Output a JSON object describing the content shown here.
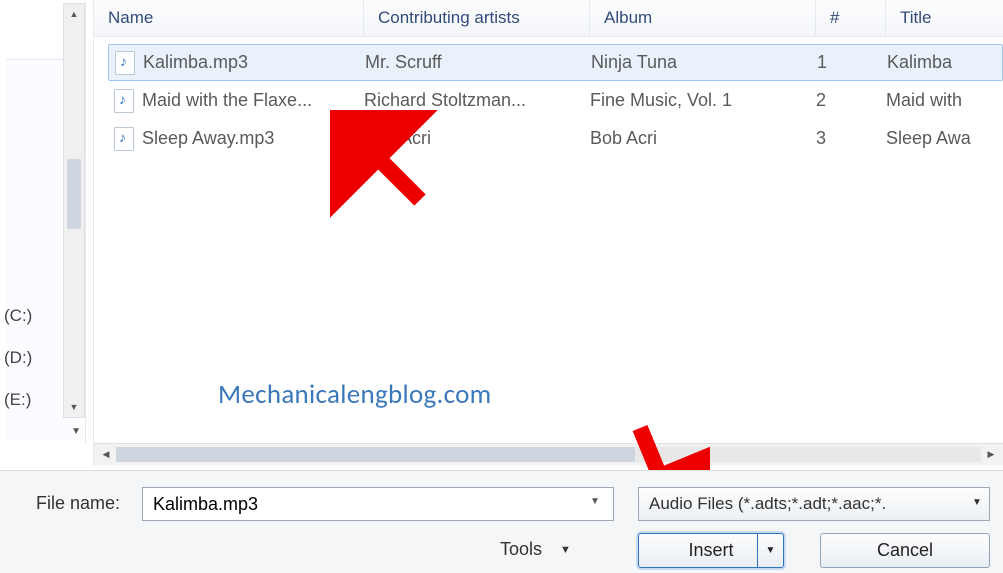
{
  "columns": {
    "name": "Name",
    "artist": "Contributing artists",
    "album": "Album",
    "num": "#",
    "title": "Title"
  },
  "rows": [
    {
      "name": "Kalimba.mp3",
      "artist": "Mr. Scruff",
      "album": "Ninja Tuna",
      "num": "1",
      "title": "Kalimba",
      "selected": true
    },
    {
      "name": "Maid with the Flaxe...",
      "artist": "Richard Stoltzman...",
      "album": "Fine Music, Vol. 1",
      "num": "2",
      "title": "Maid with",
      "selected": false
    },
    {
      "name": "Sleep Away.mp3",
      "artist": "Bob Acri",
      "album": "Bob Acri",
      "num": "3",
      "title": "Sleep Awa",
      "selected": false
    }
  ],
  "drives": [
    "(C:)",
    "(D:)",
    "(E:)"
  ],
  "watermark": "Mechanicalengblog.com",
  "bottom": {
    "file_label": "File name:",
    "file_value": "Kalimba.mp3",
    "filter": "Audio Files (*.adts;*.adt;*.aac;*.",
    "tools": "Tools",
    "insert": "Insert",
    "cancel": "Cancel"
  }
}
